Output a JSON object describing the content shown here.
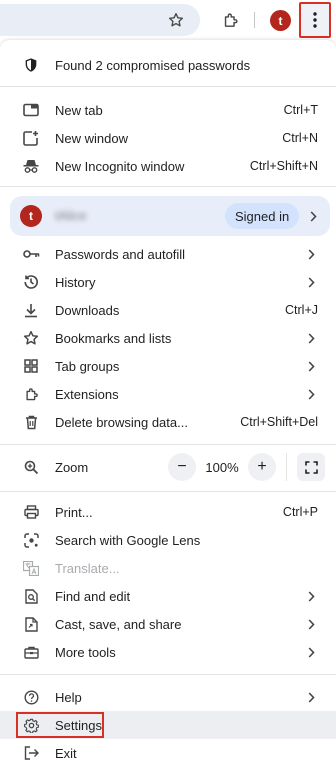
{
  "toolbar": {
    "avatar_letter": "t",
    "star_icon": "star-outline-icon",
    "extensions_icon": "puzzle-icon",
    "menu_icon": "three-dots-vertical-icon",
    "menu_highlight_color": "#d93025"
  },
  "alert": {
    "label": "Found 2 compromised passwords",
    "icon": "shield-icon"
  },
  "section1": [
    {
      "label": "New tab",
      "shortcut": "Ctrl+T",
      "icon": "new-tab-icon"
    },
    {
      "label": "New window",
      "shortcut": "Ctrl+N",
      "icon": "new-window-icon"
    },
    {
      "label": "New Incognito window",
      "shortcut": "Ctrl+Shift+N",
      "icon": "incognito-icon"
    }
  ],
  "profile": {
    "avatar_letter": "t",
    "name": "tAlice",
    "status": "Signed in",
    "accent": "#d3e3fd"
  },
  "section2": [
    {
      "label": "Passwords and autofill",
      "icon": "key-icon",
      "submenu": true
    },
    {
      "label": "History",
      "icon": "history-icon",
      "submenu": true
    },
    {
      "label": "Downloads",
      "shortcut": "Ctrl+J",
      "icon": "download-icon"
    },
    {
      "label": "Bookmarks and lists",
      "icon": "star-icon",
      "submenu": true
    },
    {
      "label": "Tab groups",
      "icon": "grid-icon",
      "submenu": true
    },
    {
      "label": "Extensions",
      "icon": "puzzle-icon",
      "submenu": true
    },
    {
      "label": "Delete browsing data...",
      "shortcut": "Ctrl+Shift+Del",
      "icon": "trash-icon"
    }
  ],
  "zoom": {
    "label": "Zoom",
    "value": "100%",
    "minus": "−",
    "plus": "+",
    "icon": "zoom-icon"
  },
  "section3": [
    {
      "label": "Print...",
      "shortcut": "Ctrl+P",
      "icon": "printer-icon"
    },
    {
      "label": "Search with Google Lens",
      "icon": "lens-icon"
    },
    {
      "label": "Translate...",
      "icon": "translate-icon",
      "disabled": true
    },
    {
      "label": "Find and edit",
      "icon": "find-icon",
      "submenu": true
    },
    {
      "label": "Cast, save, and share",
      "icon": "cast-icon",
      "submenu": true
    },
    {
      "label": "More tools",
      "icon": "toolbox-icon",
      "submenu": true
    }
  ],
  "section4": [
    {
      "label": "Help",
      "icon": "help-icon",
      "submenu": true
    },
    {
      "label": "Settings",
      "icon": "gear-icon",
      "highlighted": true
    },
    {
      "label": "Exit",
      "icon": "exit-icon"
    }
  ]
}
